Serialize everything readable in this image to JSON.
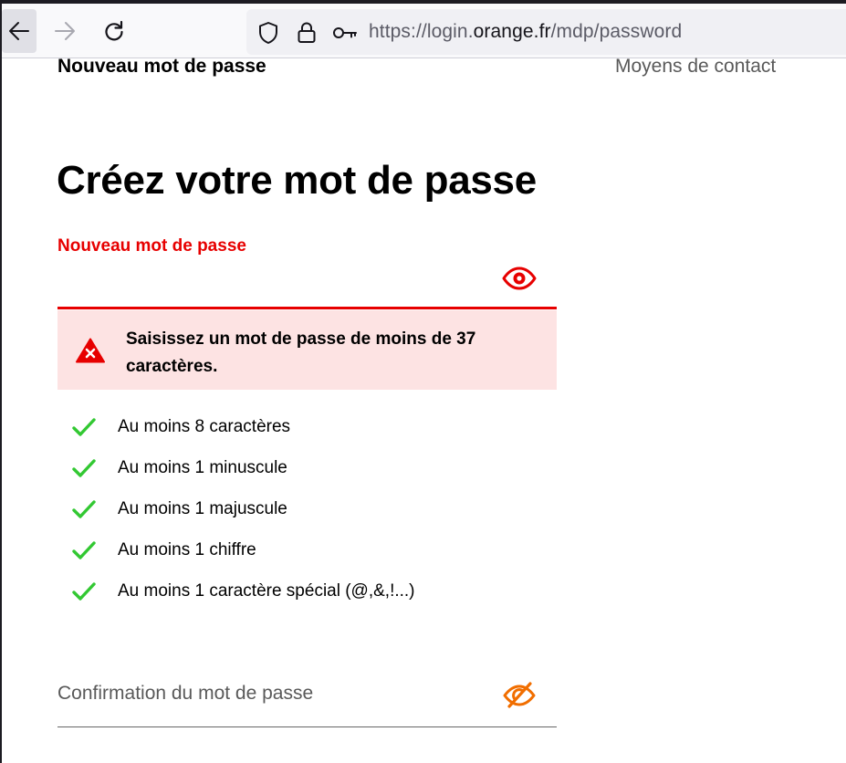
{
  "browser": {
    "url_prefix": "https://login.",
    "url_domain": "orange.fr",
    "url_path": "/mdp/password"
  },
  "header": {
    "title": "Nouveau mot de passe",
    "contact_link": "Moyens de contact"
  },
  "main": {
    "title": "Créez votre mot de passe",
    "password_label": "Nouveau mot de passe",
    "password_value": "",
    "error_message": "Saisissez un mot de passe de moins de 37 caractères.",
    "rules": [
      {
        "label": "Au moins 8 caractères",
        "satisfied": true
      },
      {
        "label": "Au moins 1 minuscule",
        "satisfied": true
      },
      {
        "label": "Au moins 1 majuscule",
        "satisfied": true
      },
      {
        "label": "Au moins 1 chiffre",
        "satisfied": true
      },
      {
        "label": "Au moins 1 caractère spécial (@,&,!...)",
        "satisfied": true
      }
    ],
    "confirm_label": "Confirmation du mot de passe"
  },
  "colors": {
    "error_red": "#e70000",
    "error_bg": "#fde3e3",
    "check_green": "#32c832",
    "brand_orange": "#f16e00"
  },
  "icons": {
    "back": "arrow-left-icon",
    "forward": "arrow-right-icon",
    "reload": "reload-icon",
    "shield": "shield-icon",
    "lock": "lock-icon",
    "key": "key-icon",
    "eye": "eye-icon",
    "eye_off": "eye-slash-icon",
    "error": "warning-triangle-icon",
    "check": "check-icon"
  }
}
